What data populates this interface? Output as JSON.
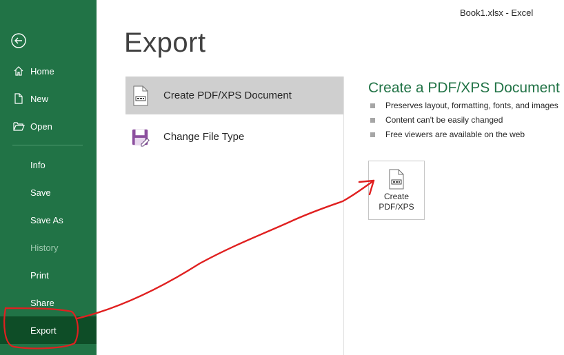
{
  "window": {
    "title": "Book1.xlsx  -  Excel"
  },
  "sidebar": {
    "items": [
      {
        "label": "Home"
      },
      {
        "label": "New"
      },
      {
        "label": "Open"
      },
      {
        "label": "Info"
      },
      {
        "label": "Save"
      },
      {
        "label": "Save As"
      },
      {
        "label": "History",
        "disabled": true
      },
      {
        "label": "Print"
      },
      {
        "label": "Share"
      },
      {
        "label": "Export",
        "active": true
      }
    ]
  },
  "main": {
    "title": "Export",
    "options": [
      {
        "label": "Create PDF/XPS Document",
        "icon": "pdf-document-icon",
        "selected": true
      },
      {
        "label": "Change File Type",
        "icon": "save-as-icon"
      }
    ],
    "detail": {
      "title": "Create a PDF/XPS Document",
      "bullets": [
        "Preserves layout, formatting, fonts, and images",
        "Content can't be easily changed",
        "Free viewers are available on the web"
      ],
      "button": {
        "line1": "Create",
        "line2": "PDF/XPS"
      }
    }
  },
  "colors": {
    "sidebar": "#217346",
    "active": "#0e4d27",
    "accent": "#217346",
    "annotation": "#e02020"
  }
}
